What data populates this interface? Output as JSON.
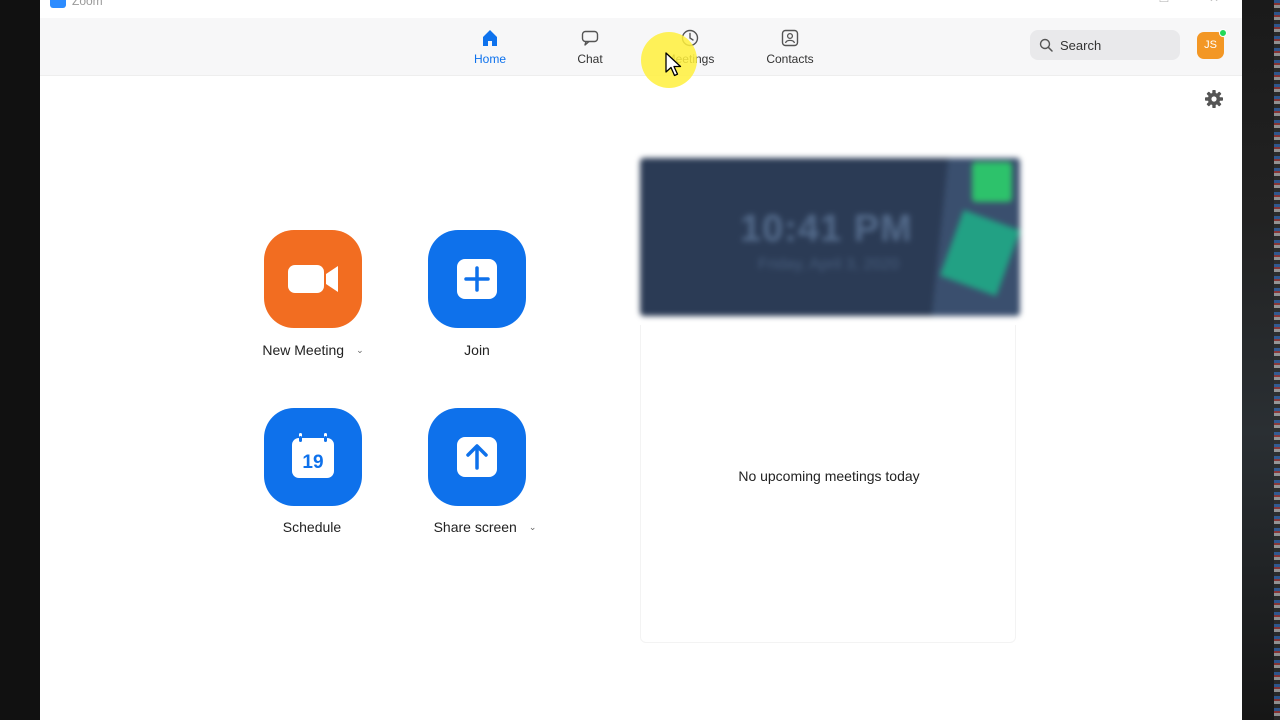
{
  "app": {
    "title": "Zoom"
  },
  "window_controls": {
    "minimize": "—",
    "maximize": "☐",
    "close": "✕"
  },
  "nav": {
    "tabs": [
      {
        "label": "Home",
        "icon": "home-icon",
        "active": true
      },
      {
        "label": "Chat",
        "icon": "chat-icon",
        "active": false
      },
      {
        "label": "Meetings",
        "icon": "clock-icon",
        "active": false
      },
      {
        "label": "Contacts",
        "icon": "contacts-icon",
        "active": false
      }
    ],
    "search": {
      "placeholder": "Search",
      "icon": "search-icon"
    },
    "avatar": {
      "initials": "JS",
      "status": "online"
    }
  },
  "actions": {
    "new_meeting": {
      "label": "New Meeting",
      "icon": "video-camera-icon",
      "color": "#f26d21"
    },
    "join": {
      "label": "Join",
      "icon": "plus-icon",
      "color": "#0e71eb"
    },
    "schedule": {
      "label": "Schedule",
      "icon": "calendar-icon",
      "calendar_day": "19",
      "color": "#0e71eb"
    },
    "share_screen": {
      "label": "Share screen",
      "icon": "upload-arrow-icon",
      "color": "#0e71eb"
    }
  },
  "clock_card": {
    "time": "10:41 PM",
    "date": "Friday, April 3, 2020"
  },
  "meetings_panel": {
    "empty_message": "No upcoming meetings today"
  },
  "colors": {
    "accent": "#0e72ed",
    "orange": "#f26d21",
    "avatar": "#f39725",
    "presence": "#23d959"
  }
}
